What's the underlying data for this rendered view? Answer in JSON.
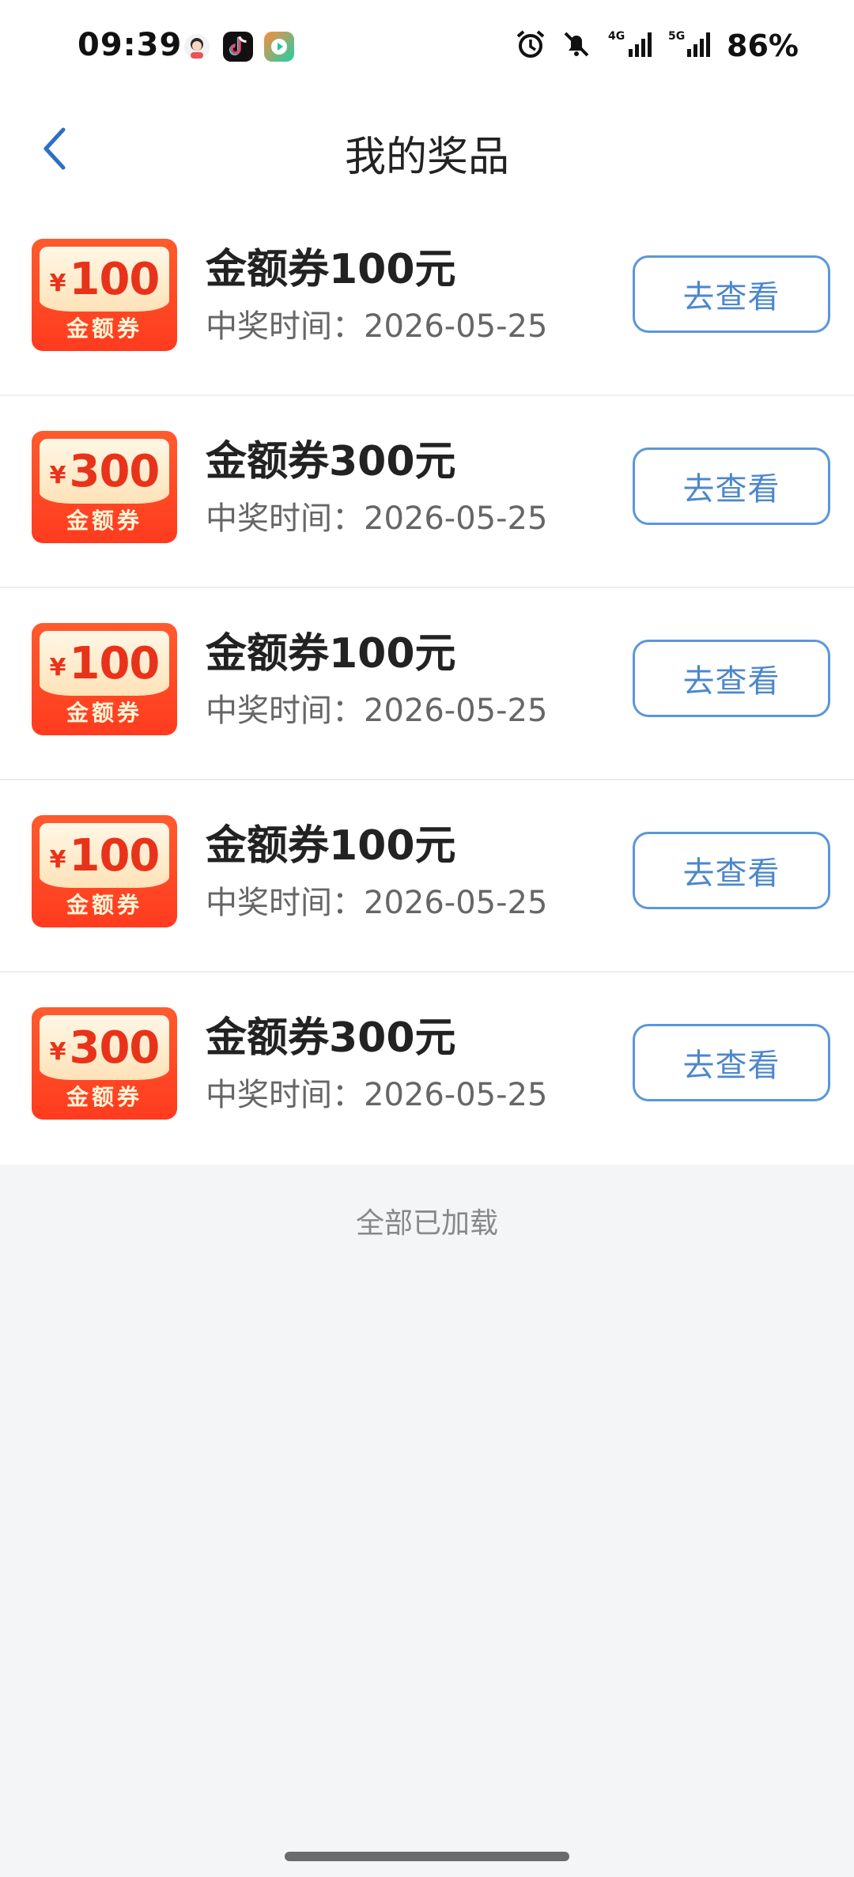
{
  "status_bar": {
    "time": "09:39",
    "battery": "86%",
    "icons": [
      "avatar-app-icon",
      "tiktok-icon",
      "video-app-icon",
      "alarm-icon",
      "mute-bell-icon",
      "signal-4g-icon",
      "signal-5g-icon"
    ]
  },
  "header": {
    "title": "我的奖品",
    "back_icon": "chevron-left-icon"
  },
  "prizes": [
    {
      "amount": "100",
      "yen": "¥",
      "coupon_label": "金额券",
      "name": "金额券100元",
      "time": "中奖时间：2026-05-25",
      "button": "去查看"
    },
    {
      "amount": "300",
      "yen": "¥",
      "coupon_label": "金额券",
      "name": "金额券300元",
      "time": "中奖时间：2026-05-25",
      "button": "去查看"
    },
    {
      "amount": "100",
      "yen": "¥",
      "coupon_label": "金额券",
      "name": "金额券100元",
      "time": "中奖时间：2026-05-25",
      "button": "去查看"
    },
    {
      "amount": "100",
      "yen": "¥",
      "coupon_label": "金额券",
      "name": "金额券100元",
      "time": "中奖时间：2026-05-25",
      "button": "去查看"
    },
    {
      "amount": "300",
      "yen": "¥",
      "coupon_label": "金额券",
      "name": "金额券300元",
      "time": "中奖时间：2026-05-25",
      "button": "去查看"
    }
  ],
  "footer": {
    "loaded_text": "全部已加载"
  },
  "colors": {
    "accent_blue": "#4c86cf",
    "coupon_red": "#ff3b1f",
    "page_bg": "#f4f5f7"
  }
}
